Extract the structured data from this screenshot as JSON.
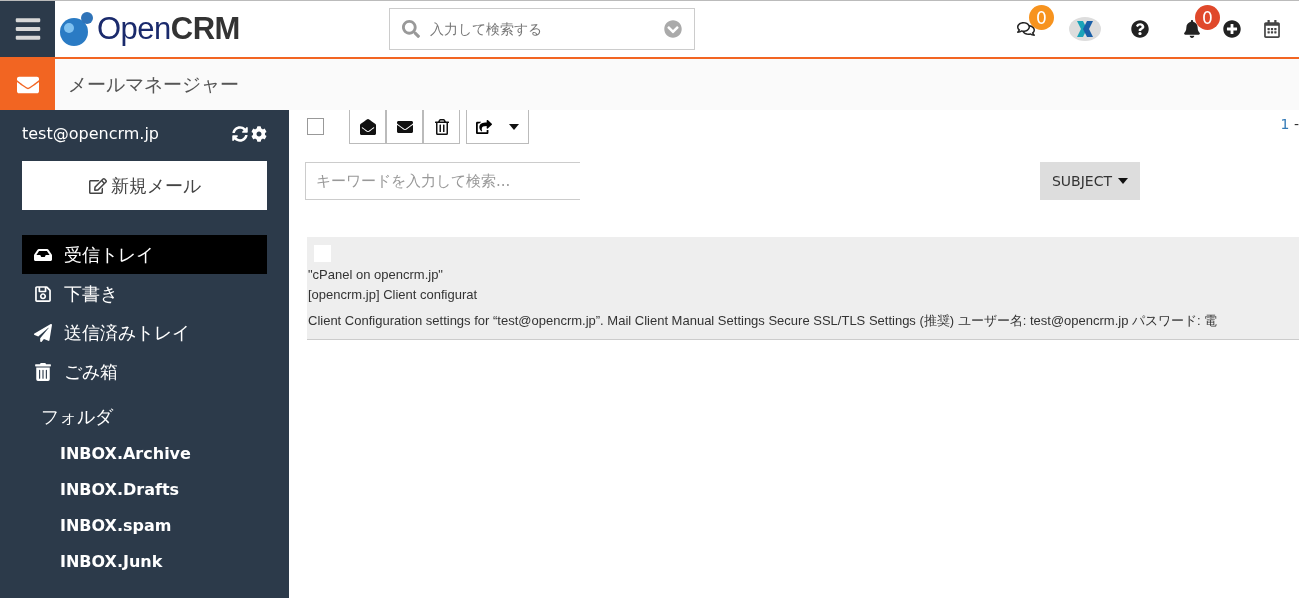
{
  "header": {
    "logo": "Open**CRM**",
    "search": {
      "placeholder": "入力して検索する"
    },
    "chat_badge": "0",
    "notification_badge": "0"
  },
  "module": {
    "title": "メールマネージャー"
  },
  "sidebar": {
    "account": "test@opencrm.jp",
    "compose_button": "新規メール",
    "items": [
      {
        "kind": "inbox",
        "label": "受信トレイ",
        "selected": true
      },
      {
        "kind": "drafts",
        "label": "下書き",
        "selected": false
      },
      {
        "kind": "sent",
        "label": "送信済みトレイ",
        "selected": false
      },
      {
        "kind": "trash",
        "label": "ごみ箱",
        "selected": false
      }
    ],
    "folders": {
      "label": "フォルダ",
      "children": [
        "INBOX.Archive",
        "INBOX.Drafts",
        "INBOX.spam",
        "INBOX.Junk"
      ]
    }
  },
  "toolbar": {
    "select_all": {
      "checked": false
    },
    "pagination": {
      "current": "1",
      "separator": "-"
    }
  },
  "filter": {
    "placeholder": "キーワードを入力して検索...",
    "field_button": "SUBJECT"
  },
  "messages": [
    {
      "checked": false,
      "from": "\"cPanel on opencrm.jp\"",
      "subject": "[opencrm.jp] Client configurat",
      "preview": "Client Configuration settings for “test@opencrm.jp”. Mail Client Manual Settings Secure SSL/TLS Settings (推奨) ユーザー名: test@opencrm.jp パスワード: 電"
    }
  ]
}
